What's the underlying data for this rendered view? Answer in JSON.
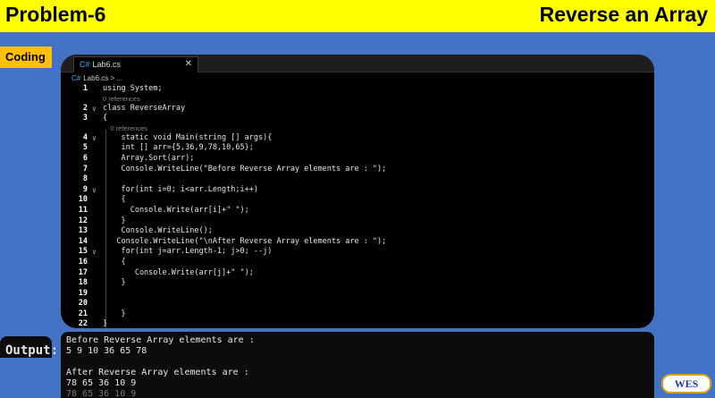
{
  "header": {
    "left_title": "Problem-6",
    "right_title": "Reverse an Array"
  },
  "labels": {
    "coding": "Coding",
    "output": "Output:"
  },
  "editor": {
    "tab_icon": "C#",
    "tab_label": "Lab6.cs",
    "close_glyph": "✕",
    "breadcrumb": "Lab6.cs > ..."
  },
  "code_lines": [
    {
      "n": "1",
      "fold": "",
      "text": "using System;"
    },
    {
      "n": "",
      "fold": "",
      "text": "0 references",
      "ref": true
    },
    {
      "n": "2",
      "fold": "∨",
      "text": "class ReverseArray"
    },
    {
      "n": "3",
      "fold": "",
      "text": "{"
    },
    {
      "n": "",
      "fold": "",
      "text": "    0 references",
      "ref": true
    },
    {
      "n": "4",
      "fold": "∨",
      "text": "    static void Main(string [] args){"
    },
    {
      "n": "5",
      "fold": "",
      "text": "    int [] arr={5,36,9,78,10,65};"
    },
    {
      "n": "6",
      "fold": "",
      "text": "    Array.Sort(arr);"
    },
    {
      "n": "7",
      "fold": "",
      "text": "    Console.WriteLine(\"Before Reverse Array elements are : \");"
    },
    {
      "n": "8",
      "fold": "",
      "text": ""
    },
    {
      "n": "9",
      "fold": "∨",
      "text": "    for(int i=0; i<arr.Length;i++)"
    },
    {
      "n": "10",
      "fold": "",
      "text": "    {"
    },
    {
      "n": "11",
      "fold": "",
      "text": "      Console.Write(arr[i]+\" \");"
    },
    {
      "n": "12",
      "fold": "",
      "text": "    }"
    },
    {
      "n": "13",
      "fold": "",
      "text": "    Console.WriteLine();"
    },
    {
      "n": "14",
      "fold": "",
      "text": "   Console.WriteLine(\"\\nAfter Reverse Array elements are : \");"
    },
    {
      "n": "15",
      "fold": "∨",
      "text": "    for(int j=arr.Length-1; j>0; --j)"
    },
    {
      "n": "16",
      "fold": "",
      "text": "    {"
    },
    {
      "n": "17",
      "fold": "",
      "text": "       Console.Write(arr[j]+\" \");"
    },
    {
      "n": "18",
      "fold": "",
      "text": "    }"
    },
    {
      "n": "19",
      "fold": "",
      "text": ""
    },
    {
      "n": "20",
      "fold": "",
      "text": ""
    },
    {
      "n": "21",
      "fold": "",
      "text": "    }"
    },
    {
      "n": "22",
      "fold": "",
      "text": "}"
    }
  ],
  "output_lines": [
    "Before Reverse Array elements are :",
    "5 9 10 36 65 78",
    "",
    "After Reverse Array elements are :",
    "78 65 36 10 9"
  ],
  "output_ghost": "78 65 36 10 9",
  "logo": "WES"
}
